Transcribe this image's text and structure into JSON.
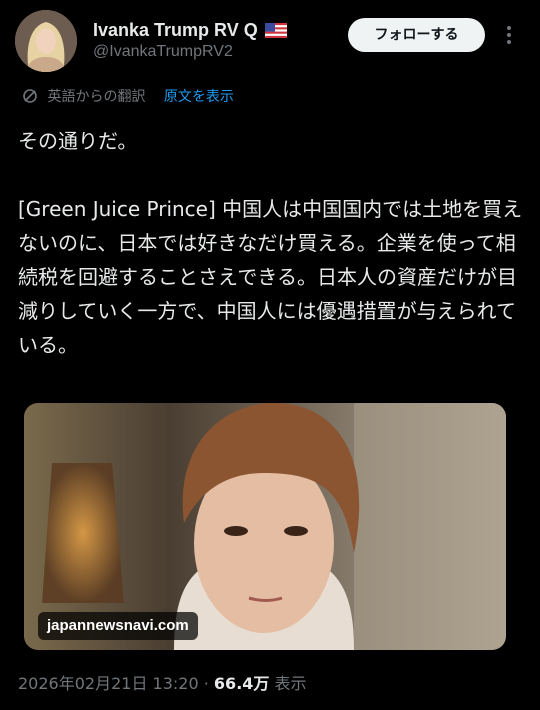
{
  "author": {
    "display_name": "Ivanka Trump RV Q",
    "flag_icon": "us-flag-icon",
    "handle": "@IvankaTrumpRV2",
    "avatar_icon": "profile-avatar"
  },
  "actions": {
    "follow_label": "フォローする",
    "more_icon": "more-vertical-icon"
  },
  "translation": {
    "icon": "translate-icon",
    "label": "英語からの翻訳",
    "show_original": "原文を表示"
  },
  "tweet": {
    "lines": [
      "その通りだ。",
      "[Green Juice Prince] 中国人は中国国内では土地を買えないのに、日本では好きなだけ買える。企業を使って相続税を回避することさえできる。日本人の資産だけが目減りしていく一方で、中国人には優遇措置が与えられている。"
    ]
  },
  "media": {
    "link_label": "japannewsnavi.com"
  },
  "meta": {
    "timestamp": "2026年02月21日 13:20",
    "separator": "·",
    "views_count": "66.4万",
    "views_label": "表示"
  },
  "colors": {
    "background": "#000000",
    "text": "#e7e9ea",
    "muted": "#71767b",
    "link": "#1d9bf0",
    "button_bg": "#eff3f4"
  }
}
